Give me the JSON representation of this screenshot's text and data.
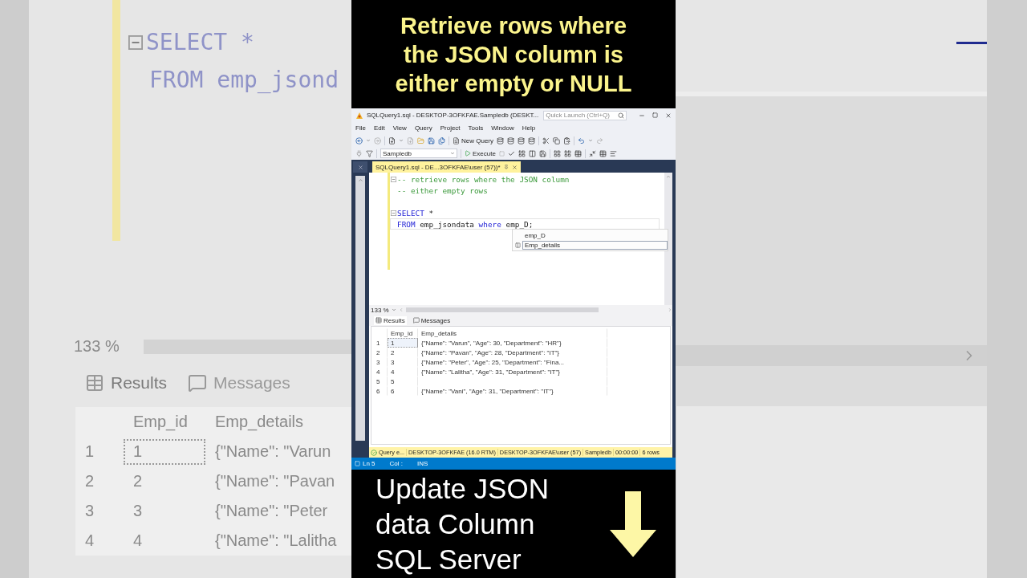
{
  "caption_top": "Retrieve rows where the JSON column is either empty or NULL",
  "backdrop": {
    "code": [
      "SELECT *",
      "FROM emp_jsond"
    ],
    "zoom": "133 %",
    "tabs": [
      {
        "label": "Results",
        "selected": true
      },
      {
        "label": "Messages",
        "selected": false
      }
    ],
    "columns": [
      "Emp_id",
      "Emp_details"
    ],
    "rows": [
      {
        "num": "1",
        "cells": [
          "1",
          "{\"Name\": \"Varun"
        ]
      },
      {
        "num": "2",
        "cells": [
          "2",
          "{\"Name\": \"Pavan"
        ]
      },
      {
        "num": "3",
        "cells": [
          "3",
          "{\"Name\": \"Peter"
        ]
      },
      {
        "num": "4",
        "cells": [
          "4",
          "{\"Name\": \"Lalitha"
        ]
      }
    ]
  },
  "window": {
    "title": "SQLQuery1.sql - DESKTOP-3OFKFAE.Sampledb (DESKT...",
    "quick_launch": "Quick Launch (Ctrl+Q)"
  },
  "menu": [
    "File",
    "Edit",
    "View",
    "Query",
    "Project",
    "Tools",
    "Window",
    "Help"
  ],
  "toolbar": {
    "new_query": "New Query",
    "database": "Sampledb",
    "execute": "Execute"
  },
  "document_tab": "SQLQuery1.sql - DE...3OFKFAE\\user (57))*",
  "editor": {
    "lines": [
      {
        "kind": "code",
        "fold": true,
        "current": false,
        "tokens": [
          {
            "kind": "comment",
            "text": "-- retrieve rows where the JSON column"
          }
        ]
      },
      {
        "kind": "code",
        "fold": false,
        "current": false,
        "tokens": [
          {
            "kind": "comment",
            "text": "-- either empty rows"
          }
        ]
      },
      {
        "kind": "blank"
      },
      {
        "kind": "code",
        "fold": true,
        "current": false,
        "tokens": [
          {
            "kind": "keyword",
            "text": "SELECT"
          },
          {
            "kind": "plain",
            "text": " *"
          }
        ]
      },
      {
        "kind": "code",
        "fold": false,
        "current": true,
        "tokens": [
          {
            "kind": "keyword",
            "text": "FROM"
          },
          {
            "kind": "plain",
            "text": " emp_jsondata "
          },
          {
            "kind": "keyword",
            "text": "where"
          },
          {
            "kind": "plain",
            "text": " emp_D;"
          }
        ]
      }
    ]
  },
  "autocomplete": [
    {
      "label": "emp_D",
      "selected": false
    },
    {
      "label": "Emp_details",
      "selected": true
    }
  ],
  "zoom": "133 %",
  "result_tabs": [
    {
      "label": "Results",
      "selected": true
    },
    {
      "label": "Messages",
      "selected": false
    }
  ],
  "grid": {
    "columns": [
      "Emp_id",
      "Emp_details"
    ],
    "rows": [
      {
        "num": "1",
        "selected": true,
        "cells": [
          "1",
          "{\"Name\": \"Varun\", \"Age\": 30, \"Department\": \"HR\"}"
        ]
      },
      {
        "num": "2",
        "selected": false,
        "cells": [
          "2",
          "{\"Name\": \"Pavan\", \"Age\": 28, \"Department\": \"IT\"}"
        ]
      },
      {
        "num": "3",
        "selected": false,
        "cells": [
          "3",
          "{\"Name\": \"Peter\", \"Age\": 25, \"Department\": \"Fina..."
        ]
      },
      {
        "num": "4",
        "selected": false,
        "cells": [
          "4",
          "{\"Name\": \"Lalitha\", \"Age\": 31, \"Department\": \"IT\"}"
        ]
      },
      {
        "num": "5",
        "selected": false,
        "cells": [
          "5"
        ]
      },
      {
        "num": "6",
        "selected": false,
        "cells": [
          "6",
          "{\"Name\": \"Vani\", \"Age\": 31, \"Department\": \"IT\"}"
        ]
      }
    ]
  },
  "status": {
    "message": "Query e...",
    "items": [
      "DESKTOP-3OFKFAE (16.0 RTM)",
      "DESKTOP-3OFKFAE\\user (57)",
      "Sampledb",
      "00:00:00",
      "6 rows"
    ]
  },
  "position": {
    "ln": "Ln 5",
    "col": "Col :",
    "mode": "INS"
  },
  "caption_bottom": "Update JSON data Column SQL Server"
}
